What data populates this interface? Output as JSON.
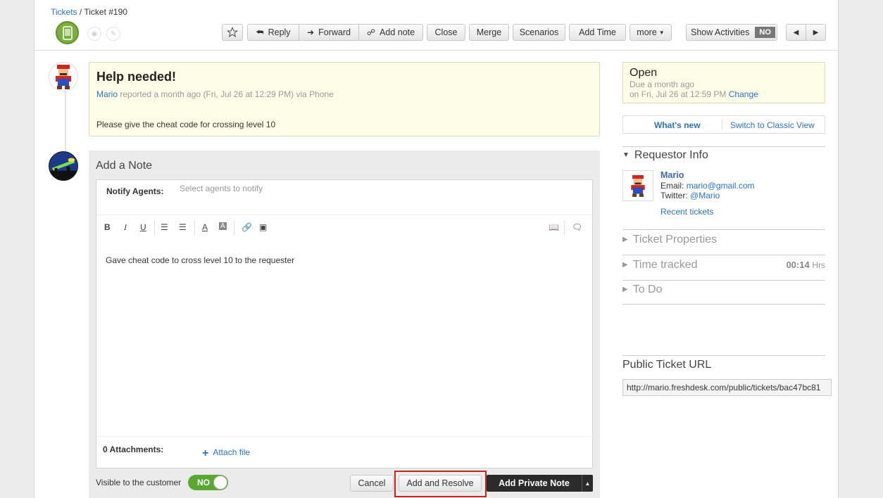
{
  "breadcrumb": {
    "root": "Tickets",
    "sep": " / ",
    "current": "Ticket #190"
  },
  "toolbar": {
    "reply": "Reply",
    "forward": "Forward",
    "add_note": "Add note",
    "close": "Close",
    "merge": "Merge",
    "scenarios": "Scenarios",
    "add_time": "Add Time",
    "more": "more",
    "show_activities": "Show Activities",
    "show_activities_state": "NO"
  },
  "ticket": {
    "title": "Help needed!",
    "author": "Mario",
    "meta": "reported a month ago (Fri, Jul 26 at 12:29 PM) via Phone",
    "body": "Please give the cheat code for crossing level 10"
  },
  "note": {
    "heading": "Add a Note",
    "notify_label": "Notify Agents:",
    "notify_placeholder": "Select agents to notify",
    "text": "Gave cheat code to cross level 10 to the requester",
    "attachments_label": "0 Attachments:",
    "attach_link": "Attach file",
    "visible_label": "Visible to the customer",
    "visible_state": "NO",
    "cancel": "Cancel",
    "add_and_resolve": "Add and Resolve",
    "add_private_note": "Add Private Note"
  },
  "status": {
    "state": "Open",
    "due_line1": "Due a month ago",
    "due_line2": "on Fri, Jul 26 at 12:59 PM",
    "change": "Change"
  },
  "view_switch": {
    "whats_new": "What's new",
    "classic": "Switch to Classic View"
  },
  "requestor": {
    "heading": "Requestor Info",
    "name": "Mario",
    "email_label": "Email:",
    "email": "mario@gmail.com",
    "twitter_label": "Twitter:",
    "twitter": "@Mario",
    "recent": "Recent tickets"
  },
  "sections": {
    "properties": "Ticket Properties",
    "time_tracked": "Time tracked",
    "time_value": "00:14",
    "time_unit": "Hrs",
    "todo": "To Do"
  },
  "public_url": {
    "heading": "Public Ticket URL",
    "value": "http://mario.freshdesk.com/public/tickets/bac47bc81"
  }
}
